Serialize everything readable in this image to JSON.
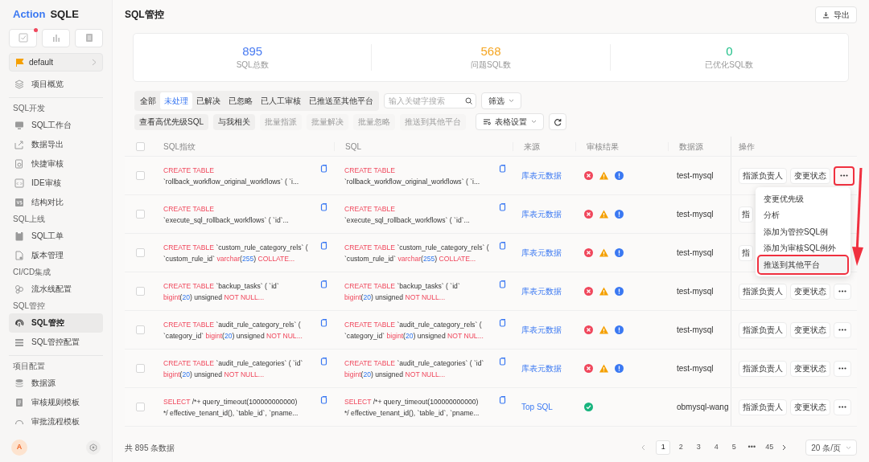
{
  "sidebar": {
    "logo": {
      "brand": "Action",
      "product": "SQLE"
    },
    "top_buttons": [
      {
        "badge": true
      },
      {
        "badge": false
      },
      {
        "badge": false
      }
    ],
    "project": "default",
    "groups": [
      {
        "items": [
          {
            "label": "项目概览",
            "selected": false
          }
        ]
      },
      {
        "title": "SQL开发",
        "items": [
          {
            "label": "SQL工作台",
            "selected": false
          },
          {
            "label": "数据导出",
            "selected": false
          },
          {
            "label": "快捷审核",
            "selected": false
          },
          {
            "label": "IDE审核",
            "selected": false
          },
          {
            "label": "结构对比",
            "selected": false
          }
        ]
      },
      {
        "title": "SQL上线",
        "items": [
          {
            "label": "SQL工单",
            "selected": false
          },
          {
            "label": "版本管理",
            "selected": false
          }
        ]
      },
      {
        "title": "CI/CD集成",
        "items": [
          {
            "label": "流水线配置",
            "selected": false
          }
        ]
      },
      {
        "title": "SQL管控",
        "items": [
          {
            "label": "SQL管控",
            "selected": true
          },
          {
            "label": "SQL管控配置",
            "selected": false
          }
        ]
      },
      {
        "title": "项目配置",
        "items": [
          {
            "label": "数据源",
            "selected": false
          },
          {
            "label": "审核规则模板",
            "selected": false
          },
          {
            "label": "审批流程模板",
            "selected": false
          }
        ]
      }
    ],
    "avatar": "A"
  },
  "header": {
    "title": "SQL管控",
    "export_button": "导出"
  },
  "stats": [
    {
      "value": "895",
      "label": "SQL总数",
      "color": "#4a7cf2"
    },
    {
      "value": "568",
      "label": "问题SQL数",
      "color": "#f5a623"
    },
    {
      "value": "0",
      "label": "已优化SQL数",
      "color": "#22c08a"
    }
  ],
  "tabs": [
    {
      "label": "全部",
      "selected": false
    },
    {
      "label": "未处理",
      "selected": true
    },
    {
      "label": "已解决",
      "selected": false
    },
    {
      "label": "已忽略",
      "selected": false
    },
    {
      "label": "已人工审核",
      "selected": false
    },
    {
      "label": "已推送至其他平台",
      "selected": false
    }
  ],
  "search": {
    "placeholder": "输入关键字搜索"
  },
  "filter_button": "筛选",
  "toolbar": {
    "buttons": [
      {
        "label": "查看高优先级SQL",
        "disabled": false
      },
      {
        "label": "与我相关",
        "disabled": false
      },
      {
        "label": "批量指派",
        "disabled": true
      },
      {
        "label": "批量解决",
        "disabled": true
      },
      {
        "label": "批量忽略",
        "disabled": true
      },
      {
        "label": "推送到其他平台",
        "disabled": true
      }
    ],
    "table_settings": "表格设置"
  },
  "table": {
    "select_all_checked": false,
    "columns": [
      "SQL指纹",
      "SQL",
      "来源",
      "审核结果",
      "数据源",
      "操作"
    ],
    "rows": [
      {
        "fingerprint": [
          [
            {
              "kind": "keyword",
              "text": "CREATE TABLE"
            }
          ],
          [
            {
              "kind": "plain",
              "text": "`rollback_workflow_original_workflows` ( `i..."
            }
          ]
        ],
        "sql": [
          [
            {
              "kind": "keyword",
              "text": "CREATE TABLE"
            }
          ],
          [
            {
              "kind": "plain",
              "text": "`rollback_workflow_original_workflows` ( `i..."
            }
          ]
        ],
        "source": "库表元数据",
        "audit": [
          {
            "kind": "error"
          },
          {
            "kind": "warning"
          },
          {
            "kind": "info"
          }
        ],
        "datasource": "test-mysql",
        "actions": [
          "指派负责人",
          "变更状态"
        ],
        "more_button": {
          "highlighted": true
        },
        "checked": false
      },
      {
        "fingerprint": [
          [
            {
              "kind": "keyword",
              "text": "CREATE TABLE"
            }
          ],
          [
            {
              "kind": "plain",
              "text": "`execute_sql_rollback_workflows` ( `id`..."
            }
          ]
        ],
        "sql": [
          [
            {
              "kind": "keyword",
              "text": "CREATE TABLE"
            }
          ],
          [
            {
              "kind": "plain",
              "text": "`execute_sql_rollback_workflows` ( `id`..."
            }
          ]
        ],
        "source": "库表元数据",
        "audit": [
          {
            "kind": "error"
          },
          {
            "kind": "warning"
          },
          {
            "kind": "info"
          }
        ],
        "datasource": "test-mysql",
        "actions": [
          "指"
        ],
        "checked": false
      },
      {
        "fingerprint": [
          [
            {
              "kind": "keyword",
              "text": "CREATE TABLE"
            },
            {
              "kind": "plain",
              "text": " `custom_rule_category_rels` ("
            }
          ],
          [
            {
              "kind": "plain",
              "text": "`custom_rule_id` "
            },
            {
              "kind": "keyword",
              "text": "varchar"
            },
            {
              "kind": "plain",
              "text": "("
            },
            {
              "kind": "number",
              "text": "255"
            },
            {
              "kind": "plain",
              "text": ") "
            },
            {
              "kind": "keyword",
              "text": "COLLATE..."
            }
          ]
        ],
        "sql": [
          [
            {
              "kind": "keyword",
              "text": "CREATE TABLE"
            },
            {
              "kind": "plain",
              "text": " `custom_rule_category_rels` ("
            }
          ],
          [
            {
              "kind": "plain",
              "text": "`custom_rule_id` "
            },
            {
              "kind": "keyword",
              "text": "varchar"
            },
            {
              "kind": "plain",
              "text": "("
            },
            {
              "kind": "number",
              "text": "255"
            },
            {
              "kind": "plain",
              "text": ") "
            },
            {
              "kind": "keyword",
              "text": "COLLATE..."
            }
          ]
        ],
        "source": "库表元数据",
        "audit": [
          {
            "kind": "error"
          },
          {
            "kind": "warning"
          },
          {
            "kind": "info"
          }
        ],
        "datasource": "test-mysql",
        "actions": [
          "指"
        ],
        "checked": false
      },
      {
        "fingerprint": [
          [
            {
              "kind": "keyword",
              "text": "CREATE TABLE"
            },
            {
              "kind": "plain",
              "text": " `backup_tasks` ( `id`"
            }
          ],
          [
            {
              "kind": "keyword",
              "text": "bigint"
            },
            {
              "kind": "plain",
              "text": "("
            },
            {
              "kind": "number",
              "text": "20"
            },
            {
              "kind": "plain",
              "text": ") unsigned "
            },
            {
              "kind": "keyword",
              "text": "NOT NULL..."
            }
          ]
        ],
        "sql": [
          [
            {
              "kind": "keyword",
              "text": "CREATE TABLE"
            },
            {
              "kind": "plain",
              "text": " `backup_tasks` ( `id`"
            }
          ],
          [
            {
              "kind": "keyword",
              "text": "bigint"
            },
            {
              "kind": "plain",
              "text": "("
            },
            {
              "kind": "number",
              "text": "20"
            },
            {
              "kind": "plain",
              "text": ") unsigned "
            },
            {
              "kind": "keyword",
              "text": "NOT NULL..."
            }
          ]
        ],
        "source": "库表元数据",
        "audit": [
          {
            "kind": "error"
          },
          {
            "kind": "warning"
          },
          {
            "kind": "info"
          }
        ],
        "datasource": "test-mysql",
        "actions": [
          "指派负责人",
          "变更状态"
        ],
        "more_button": {
          "highlighted": false
        },
        "checked": false
      },
      {
        "fingerprint": [
          [
            {
              "kind": "keyword",
              "text": "CREATE TABLE"
            },
            {
              "kind": "plain",
              "text": " `audit_rule_category_rels` ("
            }
          ],
          [
            {
              "kind": "plain",
              "text": "`category_id` "
            },
            {
              "kind": "keyword",
              "text": "bigint"
            },
            {
              "kind": "plain",
              "text": "("
            },
            {
              "kind": "number",
              "text": "20"
            },
            {
              "kind": "plain",
              "text": ") unsigned "
            },
            {
              "kind": "keyword",
              "text": "NOT NUL..."
            }
          ]
        ],
        "sql": [
          [
            {
              "kind": "keyword",
              "text": "CREATE TABLE"
            },
            {
              "kind": "plain",
              "text": " `audit_rule_category_rels` ("
            }
          ],
          [
            {
              "kind": "plain",
              "text": "`category_id` "
            },
            {
              "kind": "keyword",
              "text": "bigint"
            },
            {
              "kind": "plain",
              "text": "("
            },
            {
              "kind": "number",
              "text": "20"
            },
            {
              "kind": "plain",
              "text": ") unsigned "
            },
            {
              "kind": "keyword",
              "text": "NOT NUL..."
            }
          ]
        ],
        "source": "库表元数据",
        "audit": [
          {
            "kind": "error"
          },
          {
            "kind": "warning"
          },
          {
            "kind": "info"
          }
        ],
        "datasource": "test-mysql",
        "actions": [
          "指派负责人",
          "变更状态"
        ],
        "more_button": {
          "highlighted": false
        },
        "checked": false
      },
      {
        "fingerprint": [
          [
            {
              "kind": "keyword",
              "text": "CREATE TABLE"
            },
            {
              "kind": "plain",
              "text": " `audit_rule_categories` ( `id`"
            }
          ],
          [
            {
              "kind": "keyword",
              "text": "bigint"
            },
            {
              "kind": "plain",
              "text": "("
            },
            {
              "kind": "number",
              "text": "20"
            },
            {
              "kind": "plain",
              "text": ") unsigned "
            },
            {
              "kind": "keyword",
              "text": "NOT NULL..."
            }
          ]
        ],
        "sql": [
          [
            {
              "kind": "keyword",
              "text": "CREATE TABLE"
            },
            {
              "kind": "plain",
              "text": " `audit_rule_categories` ( `id`"
            }
          ],
          [
            {
              "kind": "keyword",
              "text": "bigint"
            },
            {
              "kind": "plain",
              "text": "("
            },
            {
              "kind": "number",
              "text": "20"
            },
            {
              "kind": "plain",
              "text": ") unsigned "
            },
            {
              "kind": "keyword",
              "text": "NOT NULL..."
            }
          ]
        ],
        "source": "库表元数据",
        "audit": [
          {
            "kind": "error"
          },
          {
            "kind": "warning"
          },
          {
            "kind": "info"
          }
        ],
        "datasource": "test-mysql",
        "actions": [
          "指派负责人",
          "变更状态"
        ],
        "more_button": {
          "highlighted": false
        },
        "checked": false
      },
      {
        "fingerprint": [
          [
            {
              "kind": "keyword",
              "text": "SELECT"
            },
            {
              "kind": "plain",
              "text": " /*+ query_timeout(100000000000)"
            }
          ],
          [
            {
              "kind": "plain",
              "text": "*/ effective_tenant_id(), `table_id`, `pname..."
            }
          ]
        ],
        "sql": [
          [
            {
              "kind": "keyword",
              "text": "SELECT"
            },
            {
              "kind": "plain",
              "text": " /*+ query_timeout(100000000000)"
            }
          ],
          [
            {
              "kind": "plain",
              "text": "*/ effective_tenant_id(), `table_id`, `pname..."
            }
          ]
        ],
        "source": "Top SQL",
        "audit": [
          {
            "kind": "success"
          }
        ],
        "datasource": "obmysql-wang",
        "actions": [
          "指派负责人",
          "变更状态"
        ],
        "more_button": {
          "highlighted": false
        },
        "checked": false
      }
    ]
  },
  "more_menu": {
    "items": [
      {
        "label": "变更优先级",
        "highlighted": false
      },
      {
        "label": "分析",
        "highlighted": false
      },
      {
        "label": "添加为管控SQL例",
        "highlighted": false
      },
      {
        "label": "添加为审核SQL例外",
        "highlighted": false
      },
      {
        "label": "推送到其他平台",
        "highlighted": true
      }
    ]
  },
  "footer": {
    "total": "共 895 条数据",
    "pages": [
      {
        "label": "1",
        "selected": true
      },
      {
        "label": "2",
        "selected": false
      },
      {
        "label": "3",
        "selected": false
      },
      {
        "label": "4",
        "selected": false
      },
      {
        "label": "5",
        "selected": false
      },
      {
        "label": "•••",
        "selected": false
      },
      {
        "label": "45",
        "selected": false
      }
    ],
    "page_size": "20 条/页"
  }
}
